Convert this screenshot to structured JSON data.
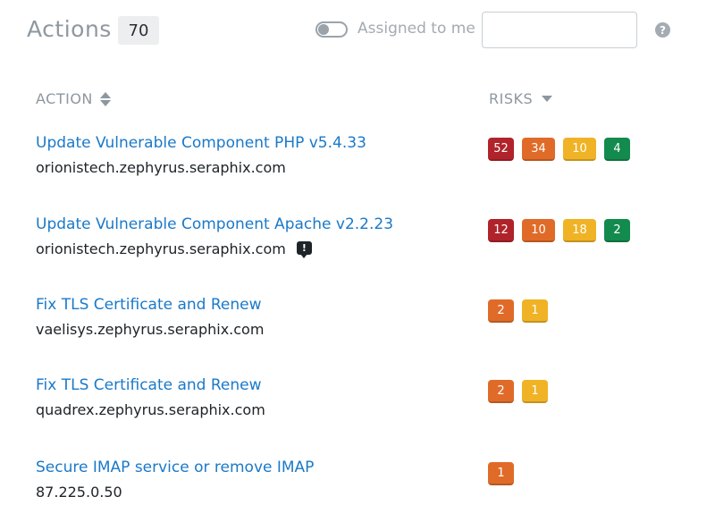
{
  "header": {
    "title": "Actions",
    "count": "70",
    "assigned_toggle_label": "Assigned to me",
    "assigned_toggle_on": false,
    "search_value": "",
    "help_glyph": "?"
  },
  "columns": {
    "action": "ACTION",
    "risks": "RISKS"
  },
  "colors": {
    "link": "#1a79c9",
    "critical": "#b0232a",
    "high": "#e06b28",
    "medium": "#f0b325",
    "low": "#138a4e"
  },
  "rows": [
    {
      "title": "Update Vulnerable Component PHP v5.4.33",
      "host": "orionistech.zephyrus.seraphix.com",
      "has_comment": false,
      "risks": {
        "critical": "52",
        "high": "34",
        "medium": "10",
        "low": "4"
      }
    },
    {
      "title": "Update Vulnerable Component Apache v2.2.23",
      "host": "orionistech.zephyrus.seraphix.com",
      "has_comment": true,
      "comment_glyph": "!",
      "risks": {
        "critical": "12",
        "high": "10",
        "medium": "18",
        "low": "2"
      }
    },
    {
      "title": "Fix TLS Certificate and Renew",
      "host": "vaelisys.zephyrus.seraphix.com",
      "has_comment": false,
      "risks": {
        "high": "2",
        "medium": "1"
      }
    },
    {
      "title": "Fix TLS Certificate and Renew",
      "host": "quadrex.zephyrus.seraphix.com",
      "has_comment": false,
      "risks": {
        "high": "2",
        "medium": "1"
      }
    },
    {
      "title": "Secure IMAP service or remove IMAP",
      "host": "87.225.0.50",
      "has_comment": false,
      "risks": {
        "high": "1"
      }
    }
  ]
}
